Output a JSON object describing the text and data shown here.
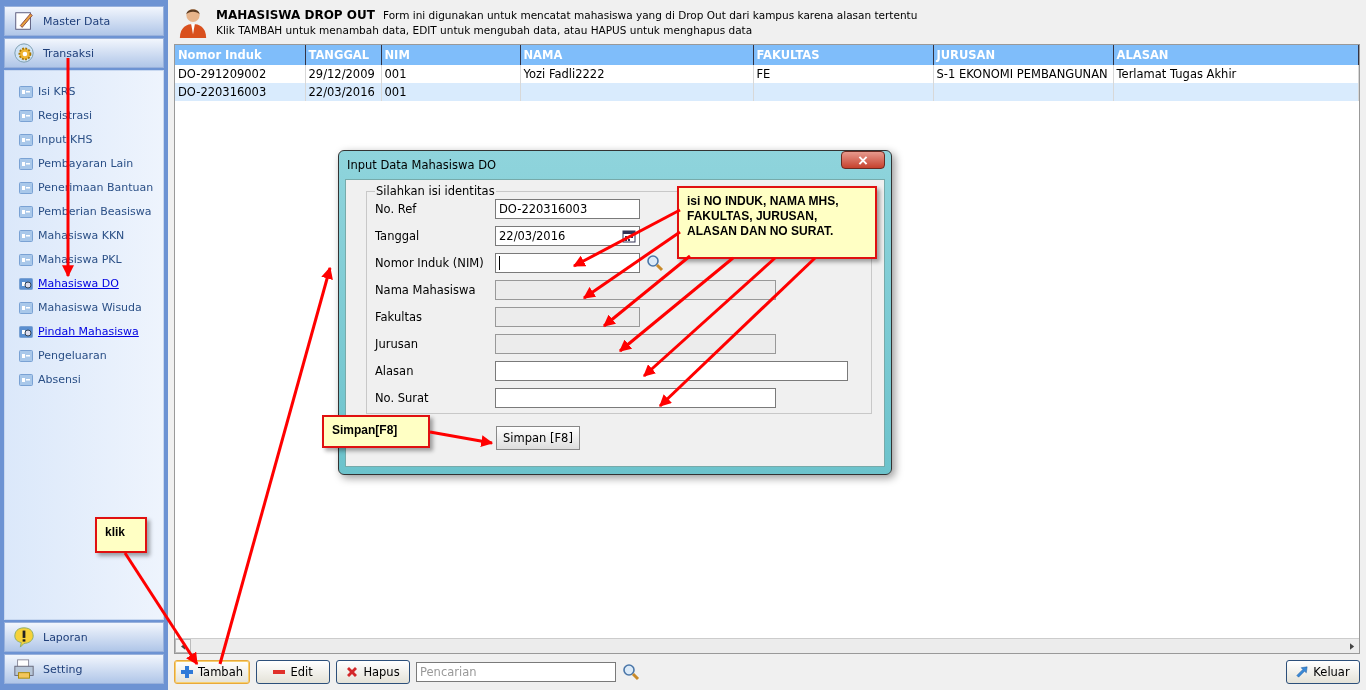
{
  "sidebar": {
    "top_sections": [
      {
        "label": "Master Data",
        "kind": "pencil"
      },
      {
        "label": "Transaksi",
        "kind": "gear"
      }
    ],
    "items": [
      {
        "label": "Isi KRS",
        "active": false
      },
      {
        "label": "Registrasi",
        "active": false
      },
      {
        "label": "Input KHS",
        "active": false
      },
      {
        "label": "Pembayaran Lain",
        "active": false
      },
      {
        "label": "Penerimaan Bantuan",
        "active": false
      },
      {
        "label": "Pemberian Beasiswa",
        "active": false
      },
      {
        "label": "Mahasiswa KKN",
        "active": false
      },
      {
        "label": "Mahasiswa PKL",
        "active": false
      },
      {
        "label": "Mahasiswa DO",
        "active": true
      },
      {
        "label": "Mahasiswa Wisuda",
        "active": false
      },
      {
        "label": "Pindah Mahasiswa",
        "active": true
      },
      {
        "label": "Pengeluaran",
        "active": false
      },
      {
        "label": "Absensi",
        "active": false
      }
    ],
    "bottom_sections": [
      {
        "label": "Laporan",
        "kind": "alert"
      },
      {
        "label": "Setting",
        "kind": "printer"
      }
    ]
  },
  "header": {
    "title": "MAHASISWA DROP OUT",
    "description": "Form ini digunakan untuk mencatat mahasiswa yang di Drop Out dari kampus karena alasan tertentu",
    "hint": "Klik TAMBAH untuk menambah data, EDIT untuk mengubah data, atau HAPUS untuk menghapus data"
  },
  "table": {
    "columns": [
      "Nomor Induk",
      "TANGGAL",
      "NIM",
      "NAMA",
      "FAKULTAS",
      "JURUSAN",
      "ALASAN"
    ],
    "rows": [
      [
        "DO-291209002",
        "29/12/2009",
        "001",
        "Yozi Fadli2222",
        "FE",
        "S-1 EKONOMI PEMBANGUNAN",
        "Terlamat Tugas Akhir"
      ],
      [
        "DO-220316003",
        "22/03/2016",
        "001",
        "",
        "",
        "",
        ""
      ]
    ]
  },
  "dialog": {
    "title": "Input Data Mahasiswa DO",
    "group_label": "Silahkan isi identitas",
    "fields": [
      {
        "label": "No. Ref",
        "value": "DO-220316003",
        "kind": "text",
        "disabled": false
      },
      {
        "label": "Tanggal",
        "value": "22/03/2016",
        "kind": "date",
        "disabled": false
      },
      {
        "label": "Nomor Induk (NIM)",
        "kind": "lookup",
        "disabled": false
      },
      {
        "label": "Nama Mahasiswa",
        "kind": "text",
        "disabled": true
      },
      {
        "label": "Fakultas",
        "kind": "text",
        "disabled": true
      },
      {
        "label": "Jurusan",
        "kind": "text",
        "disabled": true
      },
      {
        "label": "Alasan",
        "kind": "text",
        "disabled": false
      },
      {
        "label": "No. Surat",
        "kind": "text",
        "disabled": false
      }
    ],
    "save_button": "Simpan [F8]"
  },
  "callouts": [
    "isi NO INDUK, NAMA MHS, FAKULTAS, JURUSAN, ALASAN DAN NO SURAT.",
    "Simpan[F8]",
    "klik"
  ],
  "toolbar": {
    "buttons": [
      {
        "label": "Tambah",
        "kind": "add",
        "selected": true
      },
      {
        "label": "Edit",
        "kind": "edit",
        "selected": false
      },
      {
        "label": "Hapus",
        "kind": "delete",
        "selected": false
      }
    ],
    "search_placeholder": "Pencarian",
    "exit_button": "Keluar"
  }
}
